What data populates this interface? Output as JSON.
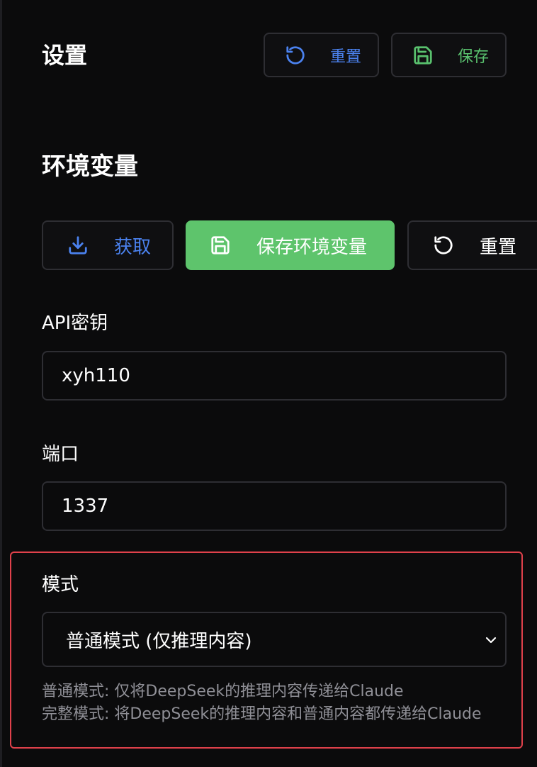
{
  "header": {
    "title": "设置",
    "reset_label": "重置",
    "save_label": "保存"
  },
  "env_section": {
    "title": "环境变量",
    "fetch_label": "获取",
    "save_env_label": "保存环境变量",
    "reset_label": "重置"
  },
  "fields": {
    "api_key": {
      "label": "API密钥",
      "value": "xyh110"
    },
    "port": {
      "label": "端口",
      "value": "1337"
    },
    "mode": {
      "label": "模式",
      "selected": "普通模式 (仅推理内容)",
      "help_line1": "普通模式: 仅将DeepSeek的推理内容传递给Claude",
      "help_line2": "完整模式: 将DeepSeek的推理内容和普通内容都传递给Claude"
    }
  },
  "icons": {
    "reset": "rotate-ccw-icon",
    "save": "floppy-disk-icon",
    "download": "download-icon",
    "chevron": "chevron-down-icon"
  },
  "colors": {
    "background": "#0b0b0c",
    "accent_blue": "#4b82ef",
    "accent_green": "#59c16e",
    "primary_green": "#5ec46c",
    "border": "#2e2e33",
    "highlight_red": "#e0414b",
    "help_text": "#8f8f96"
  }
}
